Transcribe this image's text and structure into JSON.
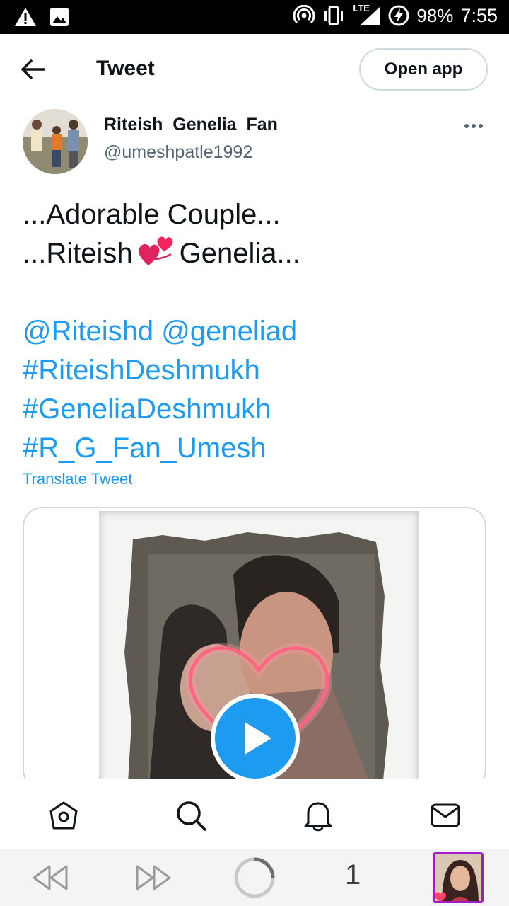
{
  "status_bar": {
    "network": "LTE",
    "battery": "98%",
    "time": "7:55",
    "icons": [
      "warning-icon",
      "image-icon",
      "hotspot-icon",
      "vibrate-icon",
      "signal-icon",
      "battery-charging-icon"
    ]
  },
  "header": {
    "title": "Tweet",
    "open_app_label": "Open app",
    "back_icon": "arrow-left-icon"
  },
  "author": {
    "name": "Riteish_Genelia_Fan",
    "handle": "@umeshpatle1992",
    "more_icon": "ellipsis-icon"
  },
  "tweet": {
    "line1": "...Adorable Couple...",
    "line2_before": "...Riteish",
    "line2_after": "Genelia...",
    "mention1": "@Riteishd",
    "mention2": "@geneliad",
    "hashtag1": "#RiteishDeshmukh",
    "hashtag2": "#GeneliaDeshmukh",
    "hashtag3": "#R_G_Fan_Umesh",
    "translate_label": "Translate Tweet"
  },
  "media": {
    "type": "video",
    "play_icon": "play-icon"
  },
  "bottom_nav": {
    "items": [
      "home-icon",
      "search-icon",
      "notifications-icon",
      "messages-icon"
    ]
  },
  "browser_bar": {
    "tab_count": "1",
    "items": [
      "rewind-icon",
      "fast-forward-icon",
      "loading-icon"
    ]
  },
  "colors": {
    "accent": "#1d9bf0",
    "text": "#0f1419",
    "muted": "#536471",
    "border": "#cfd9de"
  }
}
